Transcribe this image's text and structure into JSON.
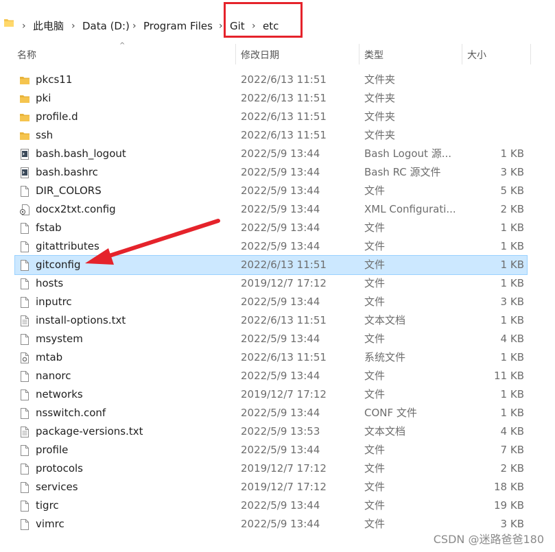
{
  "breadcrumb": {
    "items": [
      "此电脑",
      "Data (D:)",
      "Program Files",
      "Git",
      "etc"
    ]
  },
  "columns": {
    "name": "名称",
    "date": "修改日期",
    "type": "类型",
    "size": "大小"
  },
  "files": [
    {
      "name": "pkcs11",
      "date": "2022/6/13 11:51",
      "type": "文件夹",
      "size": "",
      "icon": "folder-icon"
    },
    {
      "name": "pki",
      "date": "2022/6/13 11:51",
      "type": "文件夹",
      "size": "",
      "icon": "folder-icon"
    },
    {
      "name": "profile.d",
      "date": "2022/6/13 11:51",
      "type": "文件夹",
      "size": "",
      "icon": "folder-icon"
    },
    {
      "name": "ssh",
      "date": "2022/6/13 11:51",
      "type": "文件夹",
      "size": "",
      "icon": "folder-icon"
    },
    {
      "name": "bash.bash_logout",
      "date": "2022/5/9 13:44",
      "type": "Bash Logout 源...",
      "size": "1 KB",
      "icon": "bash-file-icon"
    },
    {
      "name": "bash.bashrc",
      "date": "2022/5/9 13:44",
      "type": "Bash RC 源文件",
      "size": "3 KB",
      "icon": "bash-file-icon"
    },
    {
      "name": "DIR_COLORS",
      "date": "2022/5/9 13:44",
      "type": "文件",
      "size": "5 KB",
      "icon": "file-icon"
    },
    {
      "name": "docx2txt.config",
      "date": "2022/5/9 13:44",
      "type": "XML Configurati...",
      "size": "2 KB",
      "icon": "config-file-icon"
    },
    {
      "name": "fstab",
      "date": "2022/5/9 13:44",
      "type": "文件",
      "size": "1 KB",
      "icon": "file-icon"
    },
    {
      "name": "gitattributes",
      "date": "2022/5/9 13:44",
      "type": "文件",
      "size": "1 KB",
      "icon": "file-icon"
    },
    {
      "name": "gitconfig",
      "date": "2022/6/13 11:51",
      "type": "文件",
      "size": "1 KB",
      "icon": "file-icon",
      "selected": true
    },
    {
      "name": "hosts",
      "date": "2019/12/7 17:12",
      "type": "文件",
      "size": "1 KB",
      "icon": "file-icon"
    },
    {
      "name": "inputrc",
      "date": "2022/5/9 13:44",
      "type": "文件",
      "size": "3 KB",
      "icon": "file-icon"
    },
    {
      "name": "install-options.txt",
      "date": "2022/6/13 11:51",
      "type": "文本文档",
      "size": "1 KB",
      "icon": "text-file-icon"
    },
    {
      "name": "msystem",
      "date": "2022/5/9 13:44",
      "type": "文件",
      "size": "4 KB",
      "icon": "file-icon"
    },
    {
      "name": "mtab",
      "date": "2022/6/13 11:51",
      "type": "系统文件",
      "size": "1 KB",
      "icon": "system-file-icon"
    },
    {
      "name": "nanorc",
      "date": "2022/5/9 13:44",
      "type": "文件",
      "size": "11 KB",
      "icon": "file-icon"
    },
    {
      "name": "networks",
      "date": "2019/12/7 17:12",
      "type": "文件",
      "size": "1 KB",
      "icon": "file-icon"
    },
    {
      "name": "nsswitch.conf",
      "date": "2022/5/9 13:44",
      "type": "CONF 文件",
      "size": "1 KB",
      "icon": "file-icon"
    },
    {
      "name": "package-versions.txt",
      "date": "2022/5/9 13:53",
      "type": "文本文档",
      "size": "4 KB",
      "icon": "text-file-icon"
    },
    {
      "name": "profile",
      "date": "2022/5/9 13:44",
      "type": "文件",
      "size": "7 KB",
      "icon": "file-icon"
    },
    {
      "name": "protocols",
      "date": "2019/12/7 17:12",
      "type": "文件",
      "size": "2 KB",
      "icon": "file-icon"
    },
    {
      "name": "services",
      "date": "2019/12/7 17:12",
      "type": "文件",
      "size": "18 KB",
      "icon": "file-icon"
    },
    {
      "name": "tigrc",
      "date": "2022/5/9 13:44",
      "type": "文件",
      "size": "19 KB",
      "icon": "file-icon"
    },
    {
      "name": "vimrc",
      "date": "2022/5/9 13:44",
      "type": "文件",
      "size": "3 KB",
      "icon": "file-icon"
    }
  ],
  "colors": {
    "highlight": "#e5232b",
    "selection": "#cce8ff",
    "folder": "#f5c44e"
  },
  "watermark": "CSDN @迷路爸爸180"
}
